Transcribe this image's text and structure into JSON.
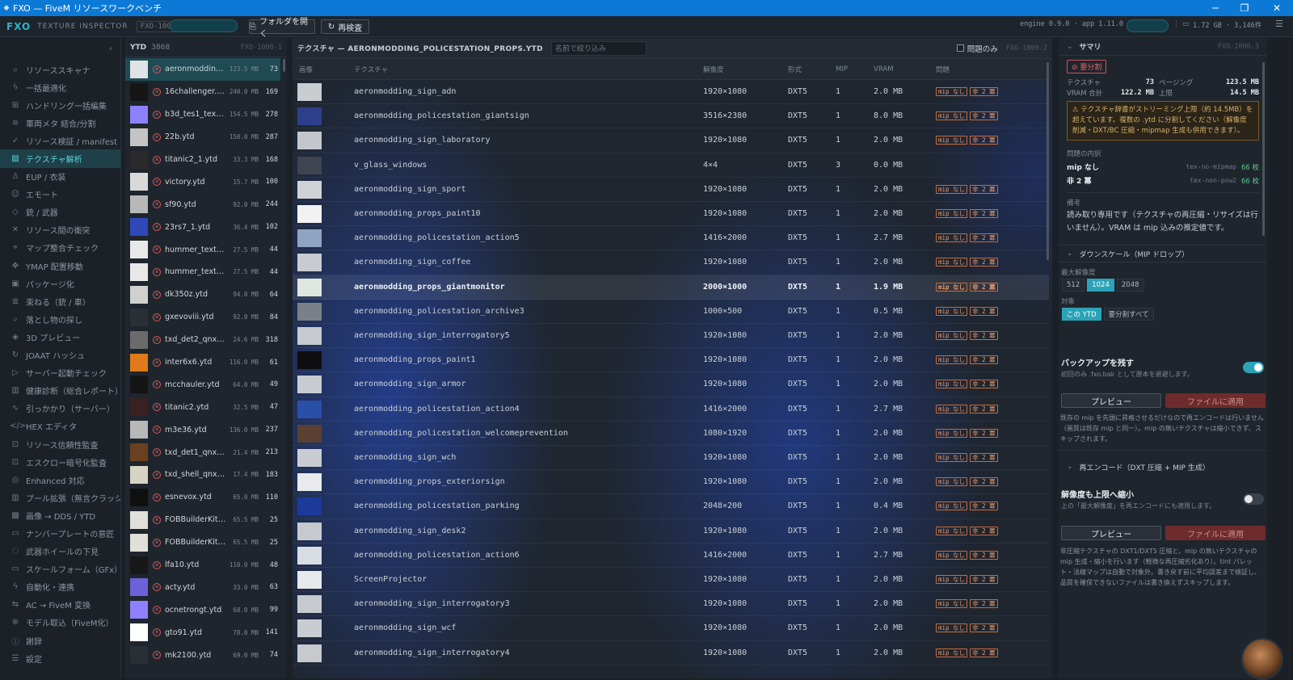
{
  "window": {
    "title": "FXO — FiveM リソースワークベンチ"
  },
  "toolbar": {
    "brand": "FXO",
    "subtitle": "TEXTURE INSPECTOR",
    "code": "FXO-1000",
    "open_folder": "フォルダを開く",
    "rescan": "再検査",
    "engine": "engine 0.9.0 · app 1.11.0",
    "storage": "1.72 GB · 3,146件"
  },
  "sidebar": {
    "items": [
      {
        "label": "リソーススキャナ",
        "icon": "search-icon",
        "glyph": "⌕"
      },
      {
        "label": "一括最適化",
        "icon": "bolt-icon",
        "glyph": "ϟ"
      },
      {
        "label": "ハンドリング一括編集",
        "icon": "grid-icon",
        "glyph": "⊞"
      },
      {
        "label": "車両メタ 結合/分割",
        "icon": "layers-icon",
        "glyph": "≋"
      },
      {
        "label": "リソース検証 / manifest",
        "icon": "check-icon",
        "glyph": "✓"
      },
      {
        "label": "テクスチャ解析",
        "icon": "texture-icon",
        "glyph": "▨"
      },
      {
        "label": "EUP / 衣装",
        "icon": "person-icon",
        "glyph": "♙"
      },
      {
        "label": "エモート",
        "icon": "emote-icon",
        "glyph": "☺"
      },
      {
        "label": "銃 / 武器",
        "icon": "diamond-icon",
        "glyph": "◇"
      },
      {
        "label": "リソース間の衝突",
        "icon": "cross-icon",
        "glyph": "✕"
      },
      {
        "label": "マップ整合チェック",
        "icon": "pin-icon",
        "glyph": "⌖"
      },
      {
        "label": "YMAP 配置移動",
        "icon": "move-icon",
        "glyph": "✥"
      },
      {
        "label": "パッケージ化",
        "icon": "package-icon",
        "glyph": "▣"
      },
      {
        "label": "束ねる（銃 / 車）",
        "icon": "stack-icon",
        "glyph": "≣"
      },
      {
        "label": "落とし物の探し",
        "icon": "find-icon",
        "glyph": "⌕"
      },
      {
        "label": "3D プレビュー",
        "icon": "cube-icon",
        "glyph": "◈"
      },
      {
        "label": "JOAAT ハッシュ",
        "icon": "refresh-icon",
        "glyph": "↻"
      },
      {
        "label": "サーバー起動チェック",
        "icon": "play-icon",
        "glyph": "▷"
      },
      {
        "label": "健康診断（総合レポート）",
        "icon": "chart-icon",
        "glyph": "▥"
      },
      {
        "label": "引っかかり（サーバー）",
        "icon": "pulse-icon",
        "glyph": "∿"
      },
      {
        "label": "HEX エディタ",
        "icon": "code-icon",
        "glyph": "</>"
      },
      {
        "label": "リソース信頼性監査",
        "icon": "lock-icon",
        "glyph": "⊡"
      },
      {
        "label": "エスクロー暗号化監査",
        "icon": "lock-icon",
        "glyph": "⊡"
      },
      {
        "label": "Enhanced 対応",
        "icon": "circle-icon",
        "glyph": "◎"
      },
      {
        "label": "プール拡張（無言クラッシ...",
        "icon": "bars-icon",
        "glyph": "▥"
      },
      {
        "label": "画像 → DDS / YTD",
        "icon": "image-grid-icon",
        "glyph": "▩"
      },
      {
        "label": "ナンバープレートの意匠",
        "icon": "plate-icon",
        "glyph": "▭"
      },
      {
        "label": "武器ホイールの下見",
        "icon": "wheel-icon",
        "glyph": "◌"
      },
      {
        "label": "スケールフォーム（GFx）",
        "icon": "frame-icon",
        "glyph": "▭"
      },
      {
        "label": "自動化・連携",
        "icon": "bolt-icon",
        "glyph": "ϟ"
      },
      {
        "label": "AC → FiveM 変換",
        "icon": "convert-icon",
        "glyph": "⇆"
      },
      {
        "label": "モデル取込（FiveM化）",
        "icon": "globe-icon",
        "glyph": "⊕"
      },
      {
        "label": "謝辞",
        "icon": "info-icon",
        "glyph": "ⓘ"
      },
      {
        "label": "設定",
        "icon": "settings-icon",
        "glyph": "☰"
      }
    ]
  },
  "ytd_panel": {
    "label": "YTD",
    "count": "3868",
    "code": "FXO-1000-1",
    "items": [
      {
        "name": "aeronmodding...",
        "size": "123.5 MB",
        "count": "73",
        "thumb": "#dfe3e6"
      },
      {
        "name": "16challenger.ytd",
        "size": "240.0 MB",
        "count": "169",
        "thumb": "#161616"
      },
      {
        "name": "b3d_tes1_textur...",
        "size": "154.5 MB",
        "count": "278",
        "thumb": "#8f80ff"
      },
      {
        "name": "22b.ytd",
        "size": "150.0 MB",
        "count": "287",
        "thumb": "#c4c4c4"
      },
      {
        "name": "titanic2_1.ytd",
        "size": "33.3 MB",
        "count": "168",
        "thumb": "#2b2b2b"
      },
      {
        "name": "victory.ytd",
        "size": "15.7 MB",
        "count": "100",
        "thumb": "#d9d9d9"
      },
      {
        "name": "sf90.ytd",
        "size": "92.0 MB",
        "count": "244",
        "thumb": "#b8b8b8"
      },
      {
        "name": "23rs7_1.ytd",
        "size": "36.4 MB",
        "count": "102",
        "thumb": "#3048b8"
      },
      {
        "name": "hummer_textur...",
        "size": "27.5 MB",
        "count": "44",
        "thumb": "#e8e8e8"
      },
      {
        "name": "hummer_textur...",
        "size": "27.5 MB",
        "count": "44",
        "thumb": "#e8e8e8"
      },
      {
        "name": "dk350z.ytd",
        "size": "94.0 MB",
        "count": "64",
        "thumb": "#d0d0d0"
      },
      {
        "name": "gxevoviii.ytd",
        "size": "92.0 MB",
        "count": "84",
        "thumb": "#2a2f36"
      },
      {
        "name": "txd_det2_qnx.ytd",
        "size": "24.6 MB",
        "count": "318",
        "thumb": "#6b6b6b"
      },
      {
        "name": "inter6x6.ytd",
        "size": "116.0 MB",
        "count": "61",
        "thumb": "#e07a1a"
      },
      {
        "name": "mcchauler.ytd",
        "size": "64.0 MB",
        "count": "49",
        "thumb": "#141414"
      },
      {
        "name": "titanic2.ytd",
        "size": "32.5 MB",
        "count": "47",
        "thumb": "#3a2020"
      },
      {
        "name": "m3e36.ytd",
        "size": "136.0 MB",
        "count": "237",
        "thumb": "#b8b8b8"
      },
      {
        "name": "txd_det1_qnx.ytd",
        "size": "21.4 MB",
        "count": "213",
        "thumb": "#6a4020"
      },
      {
        "name": "txd_shell_qnx.ytd",
        "size": "17.4 MB",
        "count": "183",
        "thumb": "#d8d4c4"
      },
      {
        "name": "esnevox.ytd",
        "size": "65.0 MB",
        "count": "110",
        "thumb": "#101010"
      },
      {
        "name": "FOBBuilderKit.ytd",
        "size": "65.5 MB",
        "count": "25",
        "thumb": "#e0e0d8"
      },
      {
        "name": "FOBBuilderKit.ytd",
        "size": "65.5 MB",
        "count": "25",
        "thumb": "#e0e0d8"
      },
      {
        "name": "lfa10.ytd",
        "size": "110.0 MB",
        "count": "48",
        "thumb": "#181818"
      },
      {
        "name": "acty.ytd",
        "size": "33.0 MB",
        "count": "63",
        "thumb": "#6e60d8"
      },
      {
        "name": "ocnetrongt.ytd",
        "size": "68.0 MB",
        "count": "99",
        "thumb": "#8f80ff"
      },
      {
        "name": "gto91.ytd",
        "size": "78.0 MB",
        "count": "141",
        "thumb": "#ffffff"
      },
      {
        "name": "mk2100.ytd",
        "size": "69.0 MB",
        "count": "74",
        "thumb": "#2a2f36"
      }
    ]
  },
  "texture_panel": {
    "title": "テクスチャ — AERONMODDING_POLICESTATION_PROPS.YTD",
    "filter_placeholder": "名前で絞り込み",
    "only_issues": "問題のみ",
    "code": "FXO-1000-2",
    "columns": {
      "image": "画像",
      "texture": "テクスチャ",
      "resolution": "解像度",
      "format": "形式",
      "mip": "MIP",
      "vram": "VRAM",
      "issues": "問題"
    },
    "issue_labels": {
      "no_mip": "mip なし",
      "non_pow2": "非 2 冪"
    },
    "rows": [
      {
        "name": "aeronmodding_sign_adn",
        "res": "1920×1080",
        "fmt": "DXT5",
        "mip": "1",
        "vram": "2.0 MB",
        "no_mip": true,
        "non_pow2": true,
        "thumb": "#c9cdd2"
      },
      {
        "name": "aeronmodding_policestation_giantsign",
        "res": "3516×2380",
        "fmt": "DXT5",
        "mip": "1",
        "vram": "8.0 MB",
        "no_mip": true,
        "non_pow2": true,
        "thumb": "#2d3f8a"
      },
      {
        "name": "aeronmodding_sign_laboratory",
        "res": "1920×1080",
        "fmt": "DXT5",
        "mip": "1",
        "vram": "2.0 MB",
        "no_mip": true,
        "non_pow2": true,
        "thumb": "#c3c7cc"
      },
      {
        "name": "v_glass_windows",
        "res": "4×4",
        "fmt": "DXT5",
        "mip": "3",
        "vram": "0.0 MB",
        "no_mip": false,
        "non_pow2": false,
        "thumb": "#3e4550"
      },
      {
        "name": "aeronmodding_sign_sport",
        "res": "1920×1080",
        "fmt": "DXT5",
        "mip": "1",
        "vram": "2.0 MB",
        "no_mip": true,
        "non_pow2": true,
        "thumb": "#d0d3d6"
      },
      {
        "name": "aeronmodding_props_paint10",
        "res": "1920×1080",
        "fmt": "DXT5",
        "mip": "1",
        "vram": "2.0 MB",
        "no_mip": true,
        "non_pow2": true,
        "thumb": "#f2f2f2"
      },
      {
        "name": "aeronmodding_policestation_action5",
        "res": "1416×2000",
        "fmt": "DXT5",
        "mip": "1",
        "vram": "2.7 MB",
        "no_mip": true,
        "non_pow2": true,
        "thumb": "#8fa4c0"
      },
      {
        "name": "aeronmodding_sign_coffee",
        "res": "1920×1080",
        "fmt": "DXT5",
        "mip": "1",
        "vram": "2.0 MB",
        "no_mip": true,
        "non_pow2": true,
        "thumb": "#c8ccd0"
      },
      {
        "name": "aeronmodding_props_giantmonitor",
        "res": "2000×1000",
        "fmt": "DXT5",
        "mip": "1",
        "vram": "1.9 MB",
        "no_mip": true,
        "non_pow2": true,
        "thumb": "#dfe6e0"
      },
      {
        "name": "aeronmodding_policestation_archive3",
        "res": "1000×500",
        "fmt": "DXT5",
        "mip": "1",
        "vram": "0.5 MB",
        "no_mip": true,
        "non_pow2": true,
        "thumb": "#7b8088"
      },
      {
        "name": "aeronmodding_sign_interrogatory5",
        "res": "1920×1080",
        "fmt": "DXT5",
        "mip": "1",
        "vram": "2.0 MB",
        "no_mip": true,
        "non_pow2": true,
        "thumb": "#c6cacf"
      },
      {
        "name": "aeronmodding_props_paint1",
        "res": "1920×1080",
        "fmt": "DXT5",
        "mip": "1",
        "vram": "2.0 MB",
        "no_mip": true,
        "non_pow2": true,
        "thumb": "#0e0e10"
      },
      {
        "name": "aeronmodding_sign_armor",
        "res": "1920×1080",
        "fmt": "DXT5",
        "mip": "1",
        "vram": "2.0 MB",
        "no_mip": true,
        "non_pow2": true,
        "thumb": "#c8ccd0"
      },
      {
        "name": "aeronmodding_policestation_action4",
        "res": "1416×2000",
        "fmt": "DXT5",
        "mip": "1",
        "vram": "2.7 MB",
        "no_mip": true,
        "non_pow2": true,
        "thumb": "#2a4fa8"
      },
      {
        "name": "aeronmodding_policestation_welcomeprevention",
        "res": "1080×1920",
        "fmt": "DXT5",
        "mip": "1",
        "vram": "2.0 MB",
        "no_mip": true,
        "non_pow2": true,
        "thumb": "#5a4030"
      },
      {
        "name": "aeronmodding_sign_wch",
        "res": "1920×1080",
        "fmt": "DXT5",
        "mip": "1",
        "vram": "2.0 MB",
        "no_mip": true,
        "non_pow2": true,
        "thumb": "#c9cdd2"
      },
      {
        "name": "aeronmodding_props_exteriorsign",
        "res": "1920×1080",
        "fmt": "DXT5",
        "mip": "1",
        "vram": "2.0 MB",
        "no_mip": true,
        "non_pow2": true,
        "thumb": "#e8eaec"
      },
      {
        "name": "aeronmodding_policestation_parking",
        "res": "2048×200",
        "fmt": "DXT5",
        "mip": "1",
        "vram": "0.4 MB",
        "no_mip": true,
        "non_pow2": true,
        "thumb": "#1c3a9a"
      },
      {
        "name": "aeronmodding_sign_desk2",
        "res": "1920×1080",
        "fmt": "DXT5",
        "mip": "1",
        "vram": "2.0 MB",
        "no_mip": true,
        "non_pow2": true,
        "thumb": "#c6cacf"
      },
      {
        "name": "aeronmodding_policestation_action6",
        "res": "1416×2000",
        "fmt": "DXT5",
        "mip": "1",
        "vram": "2.7 MB",
        "no_mip": true,
        "non_pow2": true,
        "thumb": "#d8dde4"
      },
      {
        "name": "ScreenProjector",
        "res": "1920×1080",
        "fmt": "DXT5",
        "mip": "1",
        "vram": "2.0 MB",
        "no_mip": true,
        "non_pow2": true,
        "thumb": "#e6e8ea"
      },
      {
        "name": "aeronmodding_sign_interrogatory3",
        "res": "1920×1080",
        "fmt": "DXT5",
        "mip": "1",
        "vram": "2.0 MB",
        "no_mip": true,
        "non_pow2": true,
        "thumb": "#c6cacf"
      },
      {
        "name": "aeronmodding_sign_wcf",
        "res": "1920×1080",
        "fmt": "DXT5",
        "mip": "1",
        "vram": "2.0 MB",
        "no_mip": true,
        "non_pow2": true,
        "thumb": "#c9cdd2"
      },
      {
        "name": "aeronmodding_sign_interrogatory4",
        "res": "1920×1080",
        "fmt": "DXT5",
        "mip": "1",
        "vram": "2.0 MB",
        "no_mip": true,
        "non_pow2": true,
        "thumb": "#c6cacf"
      }
    ],
    "active_index": 8
  },
  "summary": {
    "title": "サマリ",
    "code": "FXO-1000-3",
    "tag": "要分割",
    "texture_label": "テクスチャ",
    "texture_value": "73",
    "paging_label": "ページング",
    "paging_value": "123.5 MB",
    "vram_label": "VRAM 合計",
    "vram_value": "122.2 MB",
    "limit_label": "上限",
    "limit_value": "14.5 MB",
    "warning": "テクスチャ辞書がストリーミング上限（約 14.5MB）を超えています。複数の .ytd に分割してください（解像度削減・DXT/BC 圧縮・mipmap 生成も併用できます）。",
    "issues_title": "問題の内訳",
    "issues": [
      {
        "label": "mip なし",
        "code": "tex-no-mipmap",
        "count": "66 枚"
      },
      {
        "label": "非 2 冪",
        "code": "tex-non-pow2",
        "count": "66 枚"
      }
    ],
    "notes_title": "備考",
    "notes": "読み取り専用です（テクスチャの再圧縮・リサイズは行いません）。VRAM は mip 込みの推定値です。",
    "downscale": {
      "title": "ダウンスケール（MIP ドロップ）",
      "max_res_label": "最大解像度",
      "sizes": [
        "512",
        "1024",
        "2048"
      ],
      "target_label": "対象",
      "targets": [
        "この YTD",
        "要分割すべて"
      ],
      "backup_label": "バックアップを残す",
      "backup_sub": "初回のみ .fxo.bak として原本を退避します。",
      "preview": "プレビュー",
      "apply": "ファイルに適用",
      "desc": "既存の mip を先頭に昇格させるだけなので再エンコードは行いません（画質は既存 mip と同一）。mip の無いテクスチャは縮小できず、スキップされます。"
    },
    "reencode": {
      "title": "再エンコード（DXT 圧縮 + MIP 生成）",
      "cap_label": "解像度も上限へ縮小",
      "cap_sub": "上の「最大解像度」を再エンコードにも適用します。",
      "preview": "プレビュー",
      "apply": "ファイルに適用",
      "desc": "非圧縮テクスチャの DXT1/DXT5 圧縮と、mip の無いテクスチャの mip 生成・縮小を行います（軽微な再圧縮劣化あり）。tint パレット・法線マップは自動で対象外。書き戻す前に平均誤差まで検証し、品質を確保できないファイルは書き換えずスキップします。"
    }
  },
  "colors": {
    "accent": "#2aa3b8",
    "warning": "#d8b26a",
    "danger": "#d05252",
    "titlebar": "#0d79d6"
  }
}
